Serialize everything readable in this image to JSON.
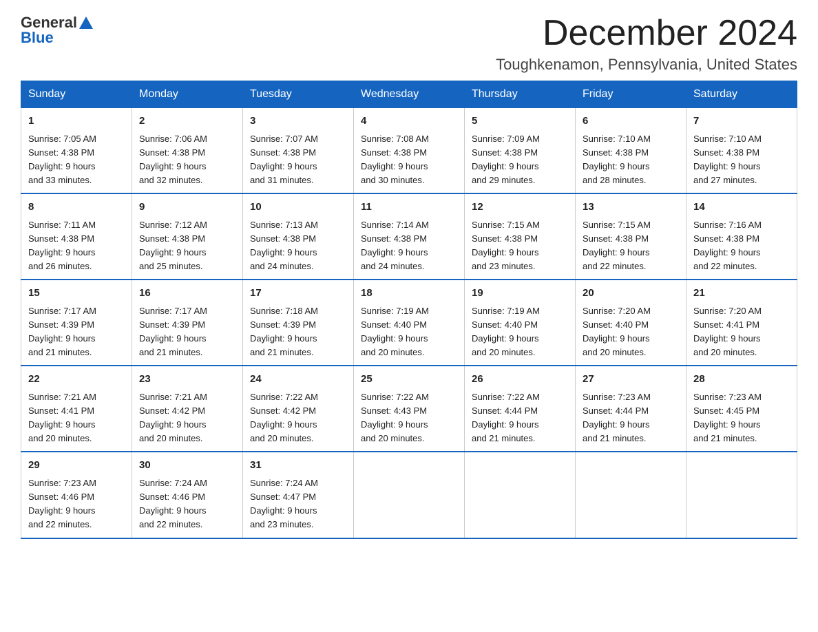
{
  "header": {
    "logo_general": "General",
    "logo_blue": "Blue",
    "month_title": "December 2024",
    "location": "Toughkenamon, Pennsylvania, United States"
  },
  "days_of_week": [
    "Sunday",
    "Monday",
    "Tuesday",
    "Wednesday",
    "Thursday",
    "Friday",
    "Saturday"
  ],
  "weeks": [
    [
      {
        "day": "1",
        "sunrise": "7:05 AM",
        "sunset": "4:38 PM",
        "daylight": "9 hours and 33 minutes."
      },
      {
        "day": "2",
        "sunrise": "7:06 AM",
        "sunset": "4:38 PM",
        "daylight": "9 hours and 32 minutes."
      },
      {
        "day": "3",
        "sunrise": "7:07 AM",
        "sunset": "4:38 PM",
        "daylight": "9 hours and 31 minutes."
      },
      {
        "day": "4",
        "sunrise": "7:08 AM",
        "sunset": "4:38 PM",
        "daylight": "9 hours and 30 minutes."
      },
      {
        "day": "5",
        "sunrise": "7:09 AM",
        "sunset": "4:38 PM",
        "daylight": "9 hours and 29 minutes."
      },
      {
        "day": "6",
        "sunrise": "7:10 AM",
        "sunset": "4:38 PM",
        "daylight": "9 hours and 28 minutes."
      },
      {
        "day": "7",
        "sunrise": "7:10 AM",
        "sunset": "4:38 PM",
        "daylight": "9 hours and 27 minutes."
      }
    ],
    [
      {
        "day": "8",
        "sunrise": "7:11 AM",
        "sunset": "4:38 PM",
        "daylight": "9 hours and 26 minutes."
      },
      {
        "day": "9",
        "sunrise": "7:12 AM",
        "sunset": "4:38 PM",
        "daylight": "9 hours and 25 minutes."
      },
      {
        "day": "10",
        "sunrise": "7:13 AM",
        "sunset": "4:38 PM",
        "daylight": "9 hours and 24 minutes."
      },
      {
        "day": "11",
        "sunrise": "7:14 AM",
        "sunset": "4:38 PM",
        "daylight": "9 hours and 24 minutes."
      },
      {
        "day": "12",
        "sunrise": "7:15 AM",
        "sunset": "4:38 PM",
        "daylight": "9 hours and 23 minutes."
      },
      {
        "day": "13",
        "sunrise": "7:15 AM",
        "sunset": "4:38 PM",
        "daylight": "9 hours and 22 minutes."
      },
      {
        "day": "14",
        "sunrise": "7:16 AM",
        "sunset": "4:38 PM",
        "daylight": "9 hours and 22 minutes."
      }
    ],
    [
      {
        "day": "15",
        "sunrise": "7:17 AM",
        "sunset": "4:39 PM",
        "daylight": "9 hours and 21 minutes."
      },
      {
        "day": "16",
        "sunrise": "7:17 AM",
        "sunset": "4:39 PM",
        "daylight": "9 hours and 21 minutes."
      },
      {
        "day": "17",
        "sunrise": "7:18 AM",
        "sunset": "4:39 PM",
        "daylight": "9 hours and 21 minutes."
      },
      {
        "day": "18",
        "sunrise": "7:19 AM",
        "sunset": "4:40 PM",
        "daylight": "9 hours and 20 minutes."
      },
      {
        "day": "19",
        "sunrise": "7:19 AM",
        "sunset": "4:40 PM",
        "daylight": "9 hours and 20 minutes."
      },
      {
        "day": "20",
        "sunrise": "7:20 AM",
        "sunset": "4:40 PM",
        "daylight": "9 hours and 20 minutes."
      },
      {
        "day": "21",
        "sunrise": "7:20 AM",
        "sunset": "4:41 PM",
        "daylight": "9 hours and 20 minutes."
      }
    ],
    [
      {
        "day": "22",
        "sunrise": "7:21 AM",
        "sunset": "4:41 PM",
        "daylight": "9 hours and 20 minutes."
      },
      {
        "day": "23",
        "sunrise": "7:21 AM",
        "sunset": "4:42 PM",
        "daylight": "9 hours and 20 minutes."
      },
      {
        "day": "24",
        "sunrise": "7:22 AM",
        "sunset": "4:42 PM",
        "daylight": "9 hours and 20 minutes."
      },
      {
        "day": "25",
        "sunrise": "7:22 AM",
        "sunset": "4:43 PM",
        "daylight": "9 hours and 20 minutes."
      },
      {
        "day": "26",
        "sunrise": "7:22 AM",
        "sunset": "4:44 PM",
        "daylight": "9 hours and 21 minutes."
      },
      {
        "day": "27",
        "sunrise": "7:23 AM",
        "sunset": "4:44 PM",
        "daylight": "9 hours and 21 minutes."
      },
      {
        "day": "28",
        "sunrise": "7:23 AM",
        "sunset": "4:45 PM",
        "daylight": "9 hours and 21 minutes."
      }
    ],
    [
      {
        "day": "29",
        "sunrise": "7:23 AM",
        "sunset": "4:46 PM",
        "daylight": "9 hours and 22 minutes."
      },
      {
        "day": "30",
        "sunrise": "7:24 AM",
        "sunset": "4:46 PM",
        "daylight": "9 hours and 22 minutes."
      },
      {
        "day": "31",
        "sunrise": "7:24 AM",
        "sunset": "4:47 PM",
        "daylight": "9 hours and 23 minutes."
      },
      null,
      null,
      null,
      null
    ]
  ],
  "labels": {
    "sunrise": "Sunrise:",
    "sunset": "Sunset:",
    "daylight": "Daylight:"
  }
}
